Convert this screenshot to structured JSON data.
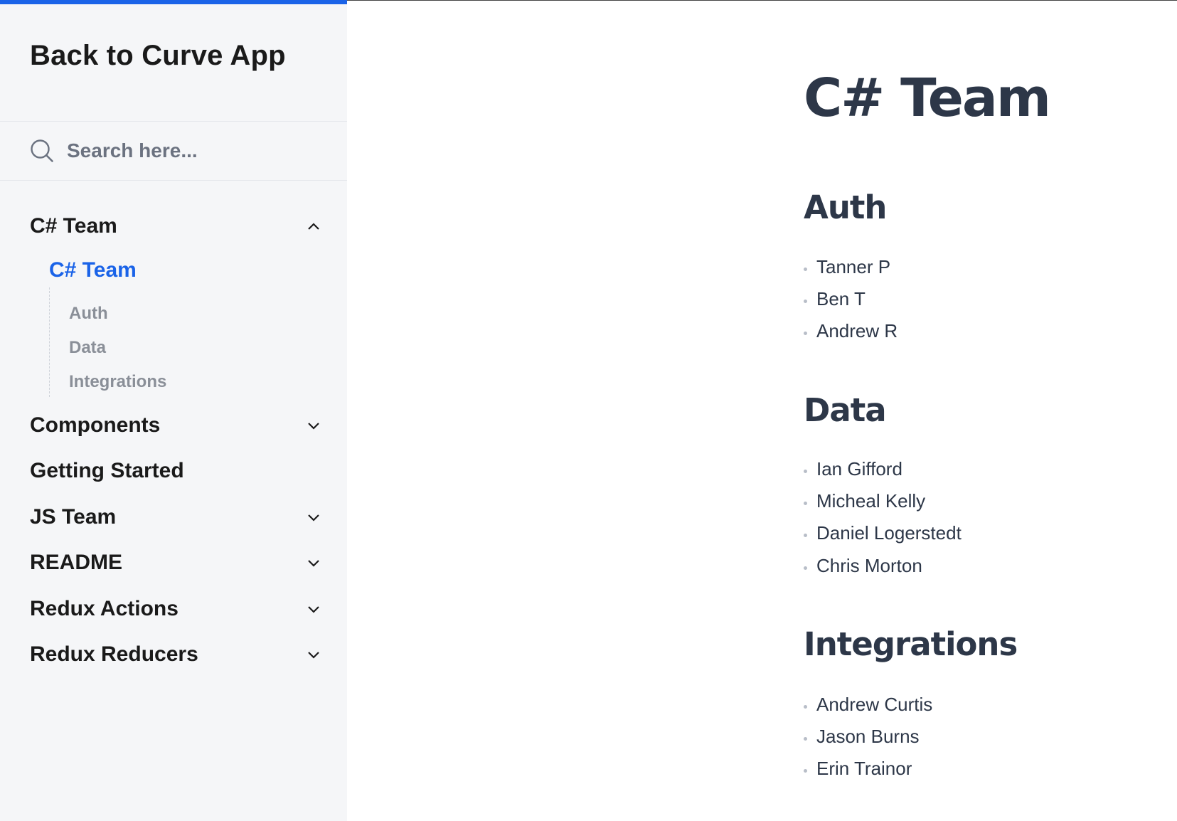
{
  "sidebar": {
    "back_link": "Back to Curve App",
    "search": {
      "placeholder": "Search here..."
    },
    "nav": [
      {
        "label": "C# Team",
        "expanded": true
      },
      {
        "label": "Components",
        "expanded": false
      },
      {
        "label": "Getting Started"
      },
      {
        "label": "JS Team",
        "expanded": false
      },
      {
        "label": "README",
        "expanded": false
      },
      {
        "label": "Redux Actions",
        "expanded": false
      },
      {
        "label": "Redux Reducers",
        "expanded": false
      }
    ],
    "active_page": "C# Team",
    "toc": [
      "Auth",
      "Data",
      "Integrations"
    ]
  },
  "main": {
    "title": "C# Team",
    "sections": [
      {
        "heading": "Auth",
        "members": [
          "Tanner P",
          "Ben T",
          "Andrew R"
        ]
      },
      {
        "heading": "Data",
        "members": [
          "Ian Gifford",
          "Micheal Kelly",
          "Daniel Logerstedt",
          "Chris Morton"
        ]
      },
      {
        "heading": "Integrations",
        "members": [
          "Andrew Curtis",
          "Jason Burns",
          "Erin Trainor"
        ]
      }
    ]
  },
  "colors": {
    "accent": "#1a63e8",
    "sidebar_bg": "#f5f6f8",
    "heading": "#2d3748"
  },
  "icons": {
    "search": "search-icon",
    "expanded": "chevron-up-icon",
    "collapsed": "chevron-down-icon"
  }
}
